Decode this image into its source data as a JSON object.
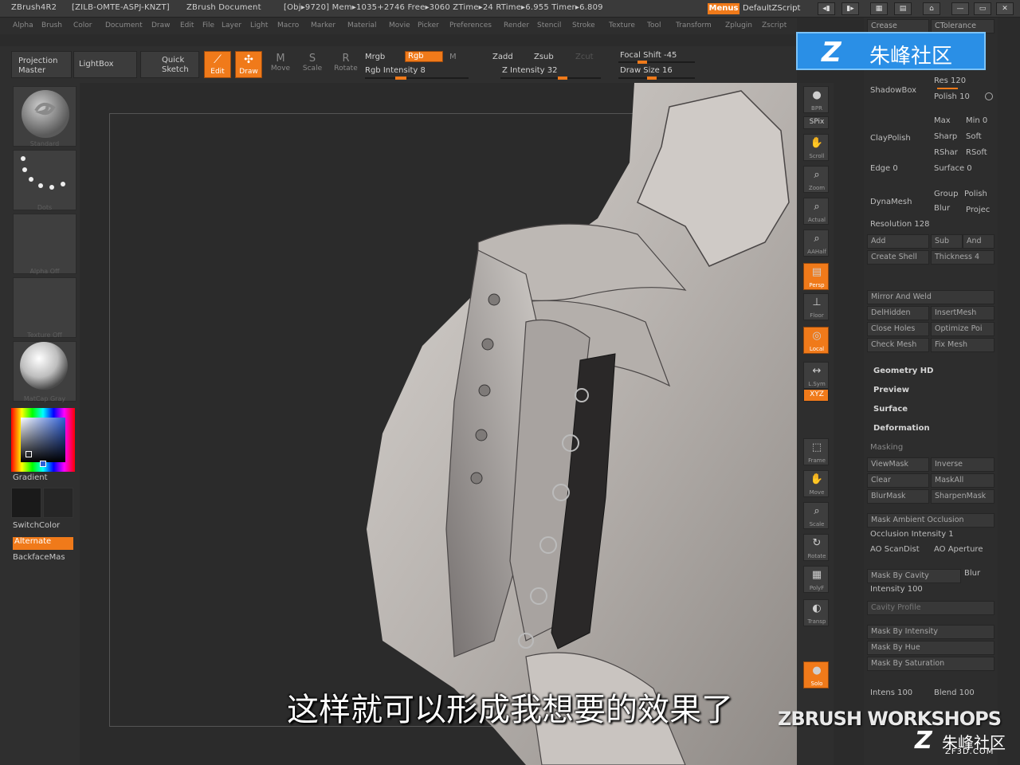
{
  "titlebar": {
    "app": "ZBrush4R2",
    "serial": "[ZILB-OMTE-ASPJ-KNZT]",
    "doc": "ZBrush Document",
    "stats": "[Obj▸9720] Mem▸1035+2746 Free▸3060 ZTime▸24 RTime▸6.955 Timer▸6.809",
    "menus": "Menus",
    "script": "DefaultZScript"
  },
  "menubar": [
    "Alpha",
    "Brush",
    "Color",
    "Document",
    "Draw",
    "Edit",
    "File",
    "Layer",
    "Light",
    "Macro",
    "Marker",
    "Material",
    "Movie",
    "Picker",
    "Preferences",
    "Render",
    "Stencil",
    "Stroke",
    "Texture",
    "Tool",
    "Transform",
    "Zplugin",
    "Zscript"
  ],
  "toolbar": {
    "projection_master": "Projection Master",
    "lightbox": "LightBox",
    "quick_sketch": "Quick Sketch",
    "edit": "Edit",
    "draw": "Draw",
    "move": "Move",
    "scale": "Scale",
    "rotate": "Rotate",
    "mrgb": "Mrgb",
    "rgb": "Rgb",
    "m": "M",
    "rgb_intensity": "Rgb Intensity 8",
    "zadd": "Zadd",
    "zsub": "Zsub",
    "zcut": "Zcut",
    "z_intensity": "Z Intensity 32",
    "focal_shift": "Focal Shift -45",
    "draw_size": "Draw Size 16"
  },
  "leftshelf": {
    "brush_label": "Standard",
    "stroke_label": "Dots",
    "alpha_label": "Alpha Off",
    "texture_label": "Texture Off",
    "material_label": "MatCap Gray",
    "gradient": "Gradient",
    "switchcolor": "SwitchColor",
    "alternate": "Alternate",
    "backfacemask": "BackfaceMas"
  },
  "rightshelf": [
    {
      "name": "bpr",
      "label": "BPR"
    },
    {
      "name": "spix",
      "label": "SPix"
    },
    {
      "name": "scroll",
      "label": "Scroll"
    },
    {
      "name": "zoom",
      "label": "Zoom"
    },
    {
      "name": "actual",
      "label": "Actual"
    },
    {
      "name": "aahalf",
      "label": "AAHalf"
    },
    {
      "name": "persp",
      "label": "Persp"
    },
    {
      "name": "floor",
      "label": "Floor"
    },
    {
      "name": "local",
      "label": "Local"
    },
    {
      "name": "lsym",
      "label": "L.Sym"
    },
    {
      "name": "xyz",
      "label": "XYZ"
    },
    {
      "name": "frame",
      "label": "Frame"
    },
    {
      "name": "move",
      "label": "Move"
    },
    {
      "name": "scale",
      "label": "Scale"
    },
    {
      "name": "rotate",
      "label": "Rotate"
    },
    {
      "name": "polyf",
      "label": "PolyF"
    },
    {
      "name": "transp",
      "label": "Transp"
    },
    {
      "name": "solo",
      "label": "Solo"
    }
  ],
  "palette": {
    "crease": "Crease",
    "ctolerance": "CTolerance",
    "shadowbox": "ShadowBox",
    "res": "Res 120",
    "polish": "Polish 10",
    "claypolish": "ClayPolish",
    "max": "Max",
    "min": "Min 0",
    "sharp": "Sharp",
    "soft": "Soft",
    "rsharp": "RShar",
    "rsoft": "RSoft",
    "edge": "Edge 0",
    "surface": "Surface 0",
    "dynamesh": "DynaMesh",
    "group": "Group",
    "polish2": "Polish",
    "blur": "Blur",
    "project": "Projec",
    "resolution": "Resolution 128",
    "add": "Add",
    "sub": "Sub",
    "and": "And",
    "create_shell": "Create Shell",
    "thickness": "Thickness 4",
    "mirror_weld": "Mirror And Weld",
    "delhidden": "DelHidden",
    "insertmesh": "InsertMesh",
    "close_holes": "Close Holes",
    "optimize": "Optimize Poi",
    "check_mesh": "Check Mesh",
    "fix_mesh": "Fix Mesh",
    "geometry_hd": "Geometry HD",
    "preview": "Preview",
    "surface_sec": "Surface",
    "deformation": "Deformation",
    "masking": "Masking",
    "viewmask": "ViewMask",
    "inverse": "Inverse",
    "clear": "Clear",
    "maskall": "MaskAll",
    "blurmask": "BlurMask",
    "sharpenmask": "SharpenMask",
    "mask_ao": "Mask Ambient Occlusion",
    "occ_intensity": "Occlusion Intensity 1",
    "ao_scandist": "AO ScanDist",
    "ao_aperture": "AO Aperture",
    "mask_cavity": "Mask By Cavity",
    "blur2": "Blur",
    "intensity": "Intensity 100",
    "cavity_profile": "Cavity Profile",
    "mask_intensity": "Mask By Intensity",
    "mask_hue": "Mask By Hue",
    "mask_saturation": "Mask By Saturation",
    "intens": "Intens 100",
    "blend": "Blend 100"
  },
  "watermark": {
    "z": "Z",
    "name": "朱峰社区",
    "workshops": "ZBRUSH WORKSHOPS",
    "corner_name": "朱峰社区",
    "url": "ZF3D.COM"
  },
  "subtitle": "这样就可以形成我想要的效果了",
  "colors": {
    "accent": "#f07a1a",
    "bg": "#2b2b2b",
    "watermark_blue": "#2a8fe6"
  }
}
